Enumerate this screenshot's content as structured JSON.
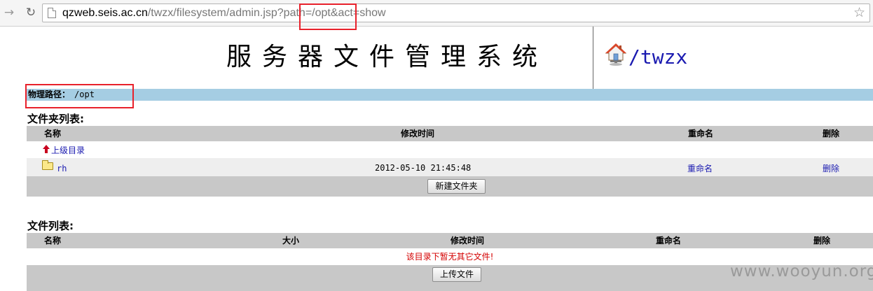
{
  "browser": {
    "url_host": "qzweb.seis.ac.cn",
    "url_rest": "/twzx/filesystem/admin.jsp?path=/opt&act=show"
  },
  "header": {
    "title": "服务器文件管理系统",
    "root_link": "/twzx"
  },
  "path": {
    "label": "物理路径：",
    "value": "/opt"
  },
  "folders": {
    "heading": "文件夹列表:",
    "columns": [
      "名称",
      "修改时间",
      "重命名",
      "删除"
    ],
    "parent_link": "上级目录",
    "rows": [
      {
        "name": "rh",
        "modified": "2012-05-10 21:45:48",
        "rename": "重命名",
        "delete": "删除"
      }
    ],
    "new_folder_button": "新建文件夹"
  },
  "files": {
    "heading": "文件列表:",
    "columns": [
      "名称",
      "大小",
      "修改时间",
      "重命名",
      "删除"
    ],
    "empty_message": "该目录下暂无其它文件!",
    "upload_button": "上传文件"
  },
  "watermark": "www.wooyun.org",
  "colors": {
    "path_bar": "#a5cde3",
    "table_header": "#c8c8c8",
    "highlight": "#e8212b",
    "link": "#1a1ab0",
    "error": "#d40000"
  }
}
